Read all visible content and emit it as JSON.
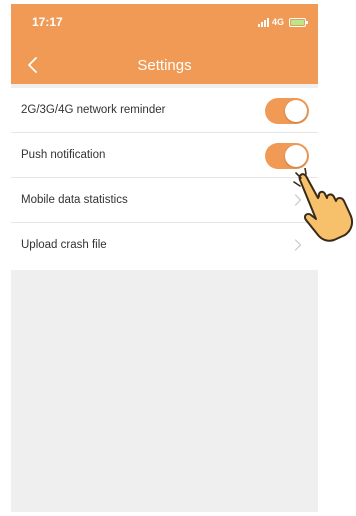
{
  "status_bar": {
    "time": "17:17",
    "network": "4G",
    "signal_icon": "signal-bars-icon",
    "battery_icon": "battery-charging-icon"
  },
  "nav": {
    "title": "Settings",
    "back_icon": "chevron-left-icon"
  },
  "settings": {
    "items": [
      {
        "label": "2G/3G/4G network reminder",
        "control": "toggle",
        "state": "on"
      },
      {
        "label": "Push notification",
        "control": "toggle",
        "state": "on"
      },
      {
        "label": "Mobile data statistics",
        "control": "chevron"
      },
      {
        "label": "Upload crash file",
        "control": "chevron"
      }
    ]
  },
  "overlay": {
    "icon": "pointing-hand-icon"
  },
  "colors": {
    "accent": "#f09a55",
    "background": "#efefef",
    "row_background": "#ffffff",
    "text": "#333333",
    "chevron": "#c7c7cc",
    "hand": "#f7c16b"
  }
}
